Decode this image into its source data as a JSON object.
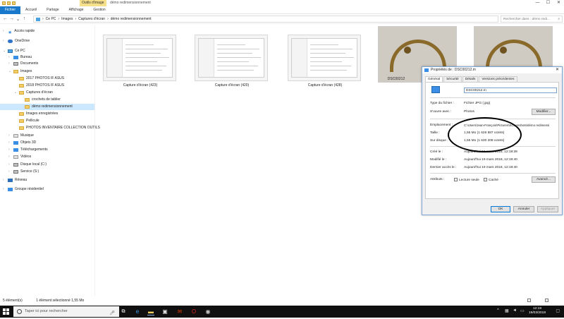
{
  "titlebar": {
    "context_tab": "Outils d'image",
    "title": "démo redimensionnement",
    "minimize": "—",
    "maximize": "☐",
    "close": "✕"
  },
  "ribbon": {
    "tabs": [
      "Fichier",
      "Accueil",
      "Partage",
      "Affichage",
      "Gestion"
    ]
  },
  "nav": {
    "back": "←",
    "forward": "→",
    "up": "↑",
    "path": [
      "Ce PC",
      "Images",
      "Captures d'écran",
      "démo redimensionnement"
    ],
    "search_placeholder": "Rechercher dans : démo redi..."
  },
  "sidebar": {
    "items": [
      {
        "label": "Accès rapide",
        "icon": "star-icon"
      },
      {
        "label": "OneDrive",
        "icon": "cloud-icon"
      },
      {
        "label": "Ce PC",
        "icon": "computer-icon"
      },
      {
        "label": "Bureau",
        "icon": "folder-icon"
      },
      {
        "label": "Documents",
        "icon": "folder-icon"
      },
      {
        "label": "Images",
        "icon": "folder-icon"
      },
      {
        "label": "2017 PHOTOS IF ASUS",
        "icon": "folder-icon"
      },
      {
        "label": "2018 PHOTOS IF ASUS",
        "icon": "folder-icon"
      },
      {
        "label": "Captures d'écran",
        "icon": "folder-icon"
      },
      {
        "label": "crochets de tablier",
        "icon": "folder-icon"
      },
      {
        "label": "démo redimensionnement",
        "icon": "folder-icon"
      },
      {
        "label": "Images enregistrées",
        "icon": "folder-icon"
      },
      {
        "label": "Pellicule",
        "icon": "folder-icon"
      },
      {
        "label": "PHOTOS INVENTAIRE COLLECTION OUTILS",
        "icon": "folder-icon"
      },
      {
        "label": "Musique",
        "icon": "music-icon"
      },
      {
        "label": "Objets 3D",
        "icon": "cube-icon"
      },
      {
        "label": "Téléchargements",
        "icon": "download-icon"
      },
      {
        "label": "Vidéos",
        "icon": "video-icon"
      },
      {
        "label": "Disque local (C:)",
        "icon": "disk-icon"
      },
      {
        "label": "Service (S:)",
        "icon": "disk-icon"
      },
      {
        "label": "Réseau",
        "icon": "network-icon"
      },
      {
        "label": "Groupe résidentiel",
        "icon": "homegroup-icon"
      }
    ]
  },
  "files": [
    {
      "name": "Capture d'écran (423)"
    },
    {
      "name": "Capture d'écran (420)"
    },
    {
      "name": "Capture d'écran (428)"
    },
    {
      "name": "DSC00212"
    },
    {
      "name": ""
    }
  ],
  "dialog": {
    "title": "Propriétés de : DSC00212.m",
    "tabs": [
      "Général",
      "Sécurité",
      "Détails",
      "Versions précédentes"
    ],
    "filename": "DSC00212.m",
    "type_label": "Type du fichier :",
    "type_value": "Fichier JPG (.jpg)",
    "opens_label": "S'ouvre avec :",
    "opens_value": "Photos",
    "change_button": "Modifier...",
    "location_label": "Emplacement :",
    "location_value": "C:\\Users\\Jean-François\\Pictures\\Screenshots\\démo redimensi",
    "size_label": "Taille :",
    "size_value": "1,55 Mo (1 626 887 octets)",
    "disk_label": "Sur disque :",
    "disk_value": "1,55 Mo (1 630 208 octets)",
    "created_label": "Créé le :",
    "created_value": "Aujourd'hui 19 mars 2018, 12:19:39",
    "modified_label": "Modifié le :",
    "modified_value": "Aujourd'hui 19 mars 2018, 12:19:40",
    "accessed_label": "Dernier accès le :",
    "accessed_value": "Aujourd'hui 19 mars 2018, 12:19:40",
    "attr_label": "Attributs :",
    "readonly": "Lecture seule",
    "hidden": "Caché",
    "advanced": "Avancé...",
    "ok": "OK",
    "cancel": "Annuler",
    "apply": "Appliquer"
  },
  "status": {
    "count": "5 élément(s)",
    "selection": "1 élément sélectionné 1,55 Mo"
  },
  "taskbar": {
    "search": "Taper ici pour rechercher",
    "time": "12:19",
    "date": "19/03/2018"
  }
}
